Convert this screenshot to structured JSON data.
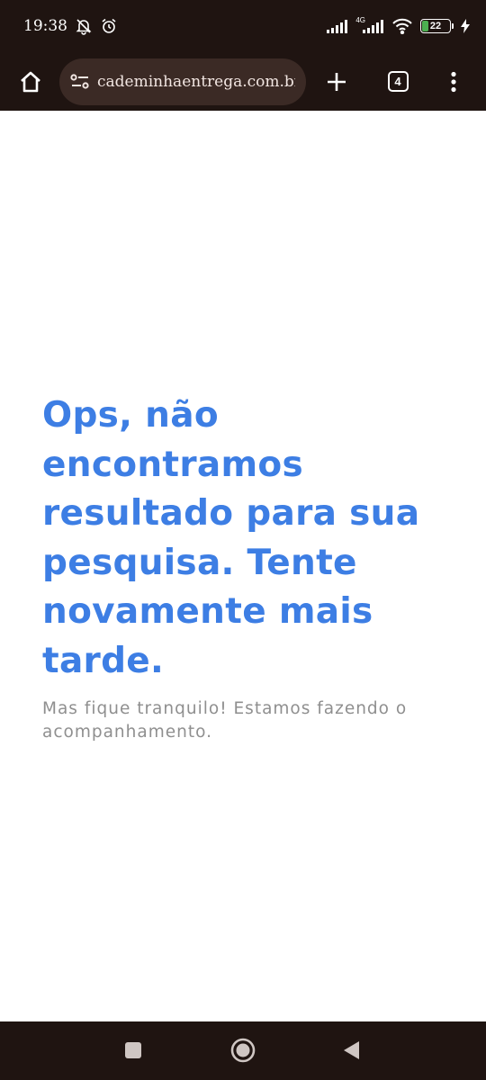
{
  "status_bar": {
    "time": "19:38",
    "network_label": "4G",
    "battery_level": "22",
    "battery_fraction": 0.22,
    "icons": [
      "notifications-off-icon",
      "alarm-icon",
      "signal-icon",
      "signal-icon",
      "wifi-icon",
      "battery-icon",
      "charging-icon"
    ]
  },
  "toolbar": {
    "url": "cademinhaentrega.com.br/em-",
    "tab_count": "4",
    "icons": [
      "home-icon",
      "site-settings-icon",
      "plus-icon",
      "more-vertical-icon"
    ]
  },
  "content": {
    "heading": "Ops, não encontramos resultado para sua pesquisa. Tente novamente mais tarde.",
    "subtext": "Mas fique tranquilo! Estamos fazendo o acompanhamento."
  },
  "nav_bar": {
    "icons": [
      "recents-square-icon",
      "home-circle-icon",
      "back-triangle-icon"
    ]
  },
  "colors": {
    "chrome": "#1f1411",
    "omnibox": "#3b2a25",
    "heading": "#3d7ee4",
    "subtext": "#8f8f8f",
    "battery": "#4caf50"
  }
}
